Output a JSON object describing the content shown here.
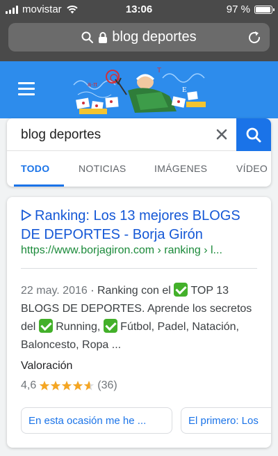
{
  "status_bar": {
    "carrier": "movistar",
    "time": "13:06",
    "battery": "97 %",
    "battery_level": 0.97
  },
  "url_bar": {
    "query": "blog deportes",
    "icons": [
      "search-icon",
      "lock-icon",
      "reload-icon"
    ]
  },
  "header": {
    "menu_icon": "hamburger-icon",
    "doodle": "google-doodle"
  },
  "search": {
    "value": "blog deportes",
    "clear_icon": "close-icon",
    "button_icon": "search-icon",
    "tabs": [
      {
        "label": "TODO",
        "active": true
      },
      {
        "label": "NOTICIAS",
        "active": false
      },
      {
        "label": "IMÁGENES",
        "active": false
      },
      {
        "label": "VÍDEO",
        "active": false
      }
    ]
  },
  "result": {
    "title": "Ranking: Los 13 mejores BLOGS DE DEPORTES - Borja Girón",
    "url": "https://www.borjagiron.com › ranking › l...",
    "snippet": {
      "date": "22 may. 2016",
      "part1": " · Ranking con el ",
      "part2": " TOP 13 BLOGS DE DEPORTES. Aprende los secretos del ",
      "part3": " Running, ",
      "part4": " Fútbol, Padel, Natación, Baloncesto, Ropa ..."
    },
    "rating_label": "Valoración",
    "rating_value": "4,6",
    "rating_stars": 4.6,
    "rating_count": "(36)",
    "chips": [
      "En esta ocasión me he ...",
      "El primero: Los"
    ]
  },
  "colors": {
    "header_blue": "#2d8cec",
    "accent_blue": "#1a73e8",
    "link_blue": "#1558d6",
    "url_green": "#1b8a3a",
    "star_orange": "#f5a623",
    "check_green": "#43b02a"
  }
}
